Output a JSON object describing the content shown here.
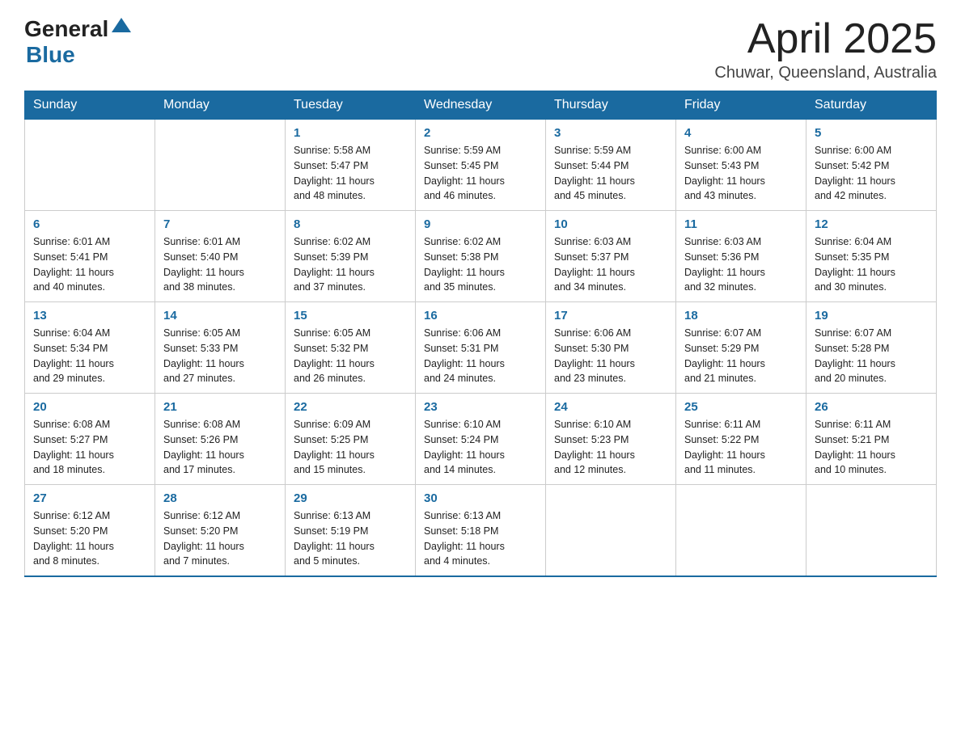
{
  "header": {
    "logo_general": "General",
    "logo_blue": "Blue",
    "title": "April 2025",
    "location": "Chuwar, Queensland, Australia"
  },
  "days_of_week": [
    "Sunday",
    "Monday",
    "Tuesday",
    "Wednesday",
    "Thursday",
    "Friday",
    "Saturday"
  ],
  "weeks": [
    [
      {
        "day": "",
        "info": ""
      },
      {
        "day": "",
        "info": ""
      },
      {
        "day": "1",
        "info": "Sunrise: 5:58 AM\nSunset: 5:47 PM\nDaylight: 11 hours\nand 48 minutes."
      },
      {
        "day": "2",
        "info": "Sunrise: 5:59 AM\nSunset: 5:45 PM\nDaylight: 11 hours\nand 46 minutes."
      },
      {
        "day": "3",
        "info": "Sunrise: 5:59 AM\nSunset: 5:44 PM\nDaylight: 11 hours\nand 45 minutes."
      },
      {
        "day": "4",
        "info": "Sunrise: 6:00 AM\nSunset: 5:43 PM\nDaylight: 11 hours\nand 43 minutes."
      },
      {
        "day": "5",
        "info": "Sunrise: 6:00 AM\nSunset: 5:42 PM\nDaylight: 11 hours\nand 42 minutes."
      }
    ],
    [
      {
        "day": "6",
        "info": "Sunrise: 6:01 AM\nSunset: 5:41 PM\nDaylight: 11 hours\nand 40 minutes."
      },
      {
        "day": "7",
        "info": "Sunrise: 6:01 AM\nSunset: 5:40 PM\nDaylight: 11 hours\nand 38 minutes."
      },
      {
        "day": "8",
        "info": "Sunrise: 6:02 AM\nSunset: 5:39 PM\nDaylight: 11 hours\nand 37 minutes."
      },
      {
        "day": "9",
        "info": "Sunrise: 6:02 AM\nSunset: 5:38 PM\nDaylight: 11 hours\nand 35 minutes."
      },
      {
        "day": "10",
        "info": "Sunrise: 6:03 AM\nSunset: 5:37 PM\nDaylight: 11 hours\nand 34 minutes."
      },
      {
        "day": "11",
        "info": "Sunrise: 6:03 AM\nSunset: 5:36 PM\nDaylight: 11 hours\nand 32 minutes."
      },
      {
        "day": "12",
        "info": "Sunrise: 6:04 AM\nSunset: 5:35 PM\nDaylight: 11 hours\nand 30 minutes."
      }
    ],
    [
      {
        "day": "13",
        "info": "Sunrise: 6:04 AM\nSunset: 5:34 PM\nDaylight: 11 hours\nand 29 minutes."
      },
      {
        "day": "14",
        "info": "Sunrise: 6:05 AM\nSunset: 5:33 PM\nDaylight: 11 hours\nand 27 minutes."
      },
      {
        "day": "15",
        "info": "Sunrise: 6:05 AM\nSunset: 5:32 PM\nDaylight: 11 hours\nand 26 minutes."
      },
      {
        "day": "16",
        "info": "Sunrise: 6:06 AM\nSunset: 5:31 PM\nDaylight: 11 hours\nand 24 minutes."
      },
      {
        "day": "17",
        "info": "Sunrise: 6:06 AM\nSunset: 5:30 PM\nDaylight: 11 hours\nand 23 minutes."
      },
      {
        "day": "18",
        "info": "Sunrise: 6:07 AM\nSunset: 5:29 PM\nDaylight: 11 hours\nand 21 minutes."
      },
      {
        "day": "19",
        "info": "Sunrise: 6:07 AM\nSunset: 5:28 PM\nDaylight: 11 hours\nand 20 minutes."
      }
    ],
    [
      {
        "day": "20",
        "info": "Sunrise: 6:08 AM\nSunset: 5:27 PM\nDaylight: 11 hours\nand 18 minutes."
      },
      {
        "day": "21",
        "info": "Sunrise: 6:08 AM\nSunset: 5:26 PM\nDaylight: 11 hours\nand 17 minutes."
      },
      {
        "day": "22",
        "info": "Sunrise: 6:09 AM\nSunset: 5:25 PM\nDaylight: 11 hours\nand 15 minutes."
      },
      {
        "day": "23",
        "info": "Sunrise: 6:10 AM\nSunset: 5:24 PM\nDaylight: 11 hours\nand 14 minutes."
      },
      {
        "day": "24",
        "info": "Sunrise: 6:10 AM\nSunset: 5:23 PM\nDaylight: 11 hours\nand 12 minutes."
      },
      {
        "day": "25",
        "info": "Sunrise: 6:11 AM\nSunset: 5:22 PM\nDaylight: 11 hours\nand 11 minutes."
      },
      {
        "day": "26",
        "info": "Sunrise: 6:11 AM\nSunset: 5:21 PM\nDaylight: 11 hours\nand 10 minutes."
      }
    ],
    [
      {
        "day": "27",
        "info": "Sunrise: 6:12 AM\nSunset: 5:20 PM\nDaylight: 11 hours\nand 8 minutes."
      },
      {
        "day": "28",
        "info": "Sunrise: 6:12 AM\nSunset: 5:20 PM\nDaylight: 11 hours\nand 7 minutes."
      },
      {
        "day": "29",
        "info": "Sunrise: 6:13 AM\nSunset: 5:19 PM\nDaylight: 11 hours\nand 5 minutes."
      },
      {
        "day": "30",
        "info": "Sunrise: 6:13 AM\nSunset: 5:18 PM\nDaylight: 11 hours\nand 4 minutes."
      },
      {
        "day": "",
        "info": ""
      },
      {
        "day": "",
        "info": ""
      },
      {
        "day": "",
        "info": ""
      }
    ]
  ]
}
